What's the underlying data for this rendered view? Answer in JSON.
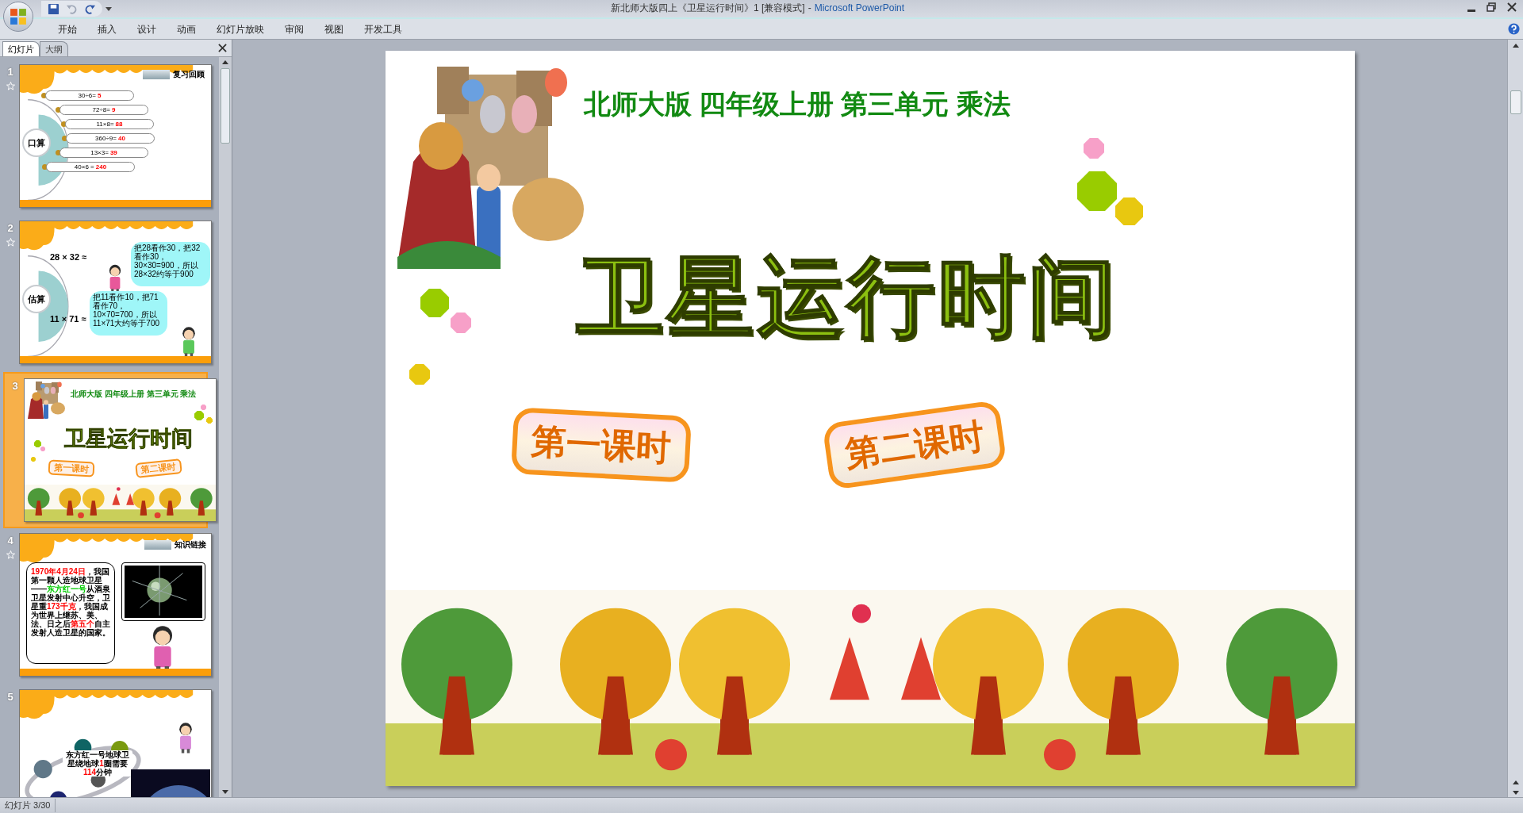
{
  "window": {
    "document": "新北师大版四上《卫星运行时间》1 [兼容模式]",
    "separator": "-",
    "app": "Microsoft PowerPoint"
  },
  "ribbon_tabs": [
    "开始",
    "插入",
    "设计",
    "动画",
    "幻灯片放映",
    "审阅",
    "视图",
    "开发工具"
  ],
  "panel_tabs": [
    {
      "label": "幻灯片",
      "selected": true
    },
    {
      "label": "大纲",
      "selected": false
    }
  ],
  "thumbnails": [
    {
      "number": "1",
      "kind": "oral",
      "selected": false,
      "animated": true,
      "plate": "复习回顾",
      "badge": "口算",
      "equations": [
        {
          "expr": "30÷6=",
          "answer": "5"
        },
        {
          "expr": "72÷8=",
          "answer": "9"
        },
        {
          "expr": "11×8=",
          "answer": "88"
        },
        {
          "expr": "360÷9=",
          "answer": "40"
        },
        {
          "expr": "13×3=",
          "answer": "39"
        },
        {
          "expr": "40×6 =",
          "answer": "240"
        }
      ]
    },
    {
      "number": "2",
      "kind": "estimate",
      "selected": false,
      "animated": true,
      "badge": "估算",
      "problems": [
        "28 × 32 ≈",
        "11 × 71 ≈"
      ],
      "bubbles": [
        "把28看作30，把32看作30，30×30=900，所以28×32约等于900",
        "把11看作10，把71看作70，10×70=700，所以11×71大约等于700"
      ]
    },
    {
      "number": "3",
      "kind": "cover",
      "selected": true,
      "animated": false,
      "subtitle": "北师大版 四年级上册 第三单元 乘法",
      "title": "卫星运行时间",
      "lessons": [
        "第一课时",
        "第二课时"
      ]
    },
    {
      "number": "4",
      "kind": "info",
      "selected": false,
      "animated": true,
      "plate": "知识链接",
      "segments": [
        {
          "text": "1970年4月24日",
          "color": "#ff0000"
        },
        {
          "text": "，我国第一颗人造地球卫星——",
          "color": "#000000"
        },
        {
          "text": "东方红一号",
          "color": "#00cc00"
        },
        {
          "text": "从酒泉卫星发射中心升空，卫星重",
          "color": "#000000"
        },
        {
          "text": "173千克",
          "color": "#ff0000"
        },
        {
          "text": "，我国成为世界上继苏、美、法、日之后",
          "color": "#000000"
        },
        {
          "text": "第五个",
          "color": "#ff0000"
        },
        {
          "text": "自主发射人造卫星的国家。",
          "color": "#000000"
        }
      ]
    },
    {
      "number": "5",
      "kind": "orbit",
      "selected": false,
      "animated": false,
      "segments": [
        {
          "text": "东方红一号地球卫星绕地球",
          "color": "#000000"
        },
        {
          "text": "1",
          "color": "#ff0000"
        },
        {
          "text": "圈需要",
          "color": "#000000"
        },
        {
          "text": "114",
          "color": "#ff0000"
        },
        {
          "text": "分钟",
          "color": "#000000"
        }
      ]
    }
  ],
  "slide": {
    "subtitle": "北师大版 四年级上册 第三单元 乘法",
    "title": "卫星运行时间",
    "lessons": [
      "第一课时",
      "第二课时"
    ]
  },
  "status_bar": {
    "slide_info": "幻灯片 3/30"
  }
}
